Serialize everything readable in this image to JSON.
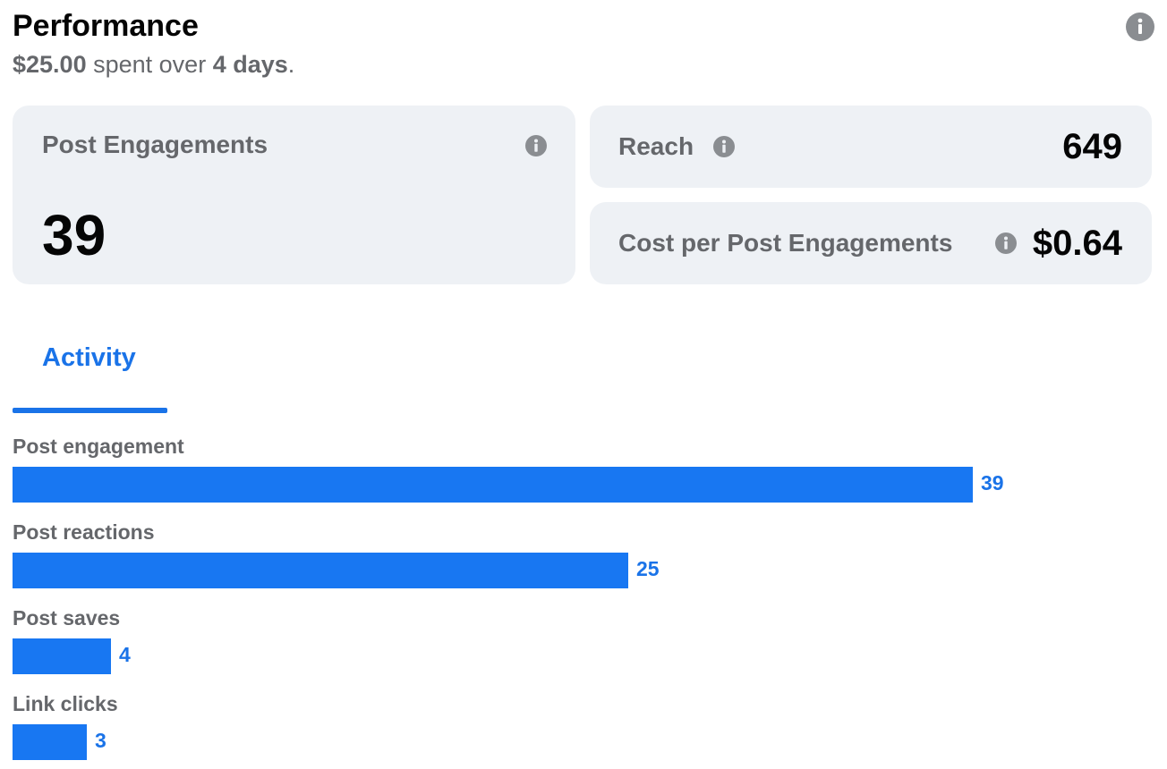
{
  "header": {
    "title": "Performance",
    "spent_amount": "$25.00",
    "spent_text": "spent over",
    "duration": "4 days",
    "period": "."
  },
  "metrics": {
    "post_engagements": {
      "label": "Post Engagements",
      "value": "39"
    },
    "reach": {
      "label": "Reach",
      "value": "649"
    },
    "cost_per_engagement": {
      "label": "Cost per Post Engagements",
      "value": "$0.64"
    }
  },
  "tabs": [
    {
      "label": "Activity",
      "active": true
    }
  ],
  "colors": {
    "accent": "#1877f2",
    "card_bg": "#eef1f5",
    "muted_text": "#65676b"
  },
  "chart_data": {
    "type": "bar",
    "orientation": "horizontal",
    "categories": [
      "Post engagement",
      "Post reactions",
      "Post saves",
      "Link clicks"
    ],
    "values": [
      39,
      25,
      4,
      3
    ],
    "xlim": [
      0,
      39
    ]
  }
}
